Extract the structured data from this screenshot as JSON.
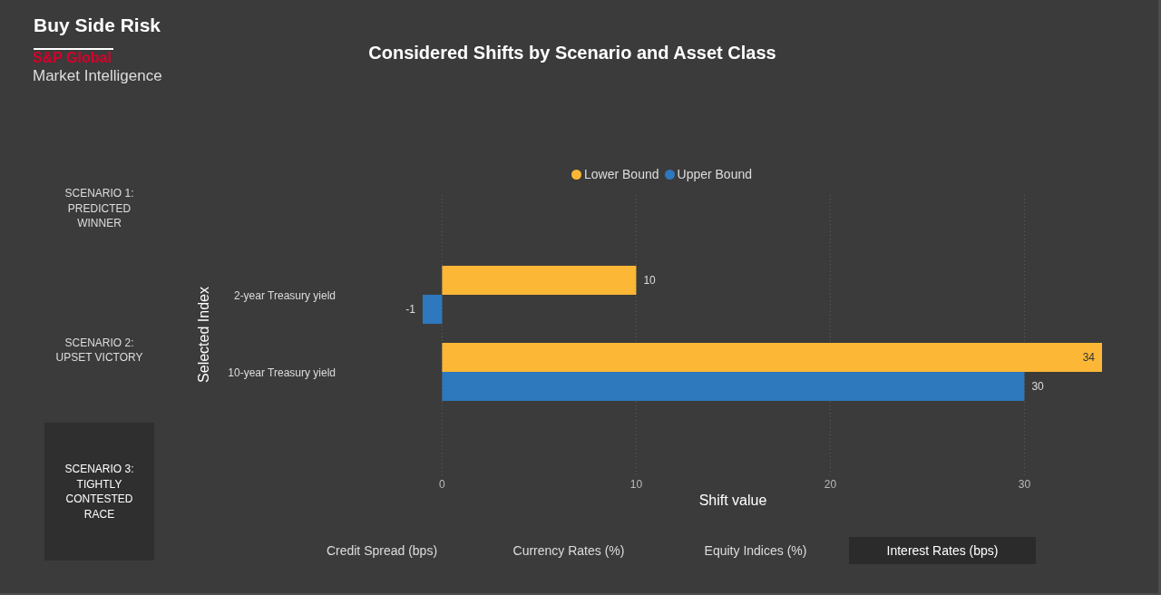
{
  "header": {
    "title": "Buy Side Risk",
    "brand": "S&P Global",
    "brand_subtitle": "Market Intelligence"
  },
  "scenarios": [
    {
      "label": "SCENARIO 1: PREDICTED WINNER",
      "selected": false
    },
    {
      "label": "SCENARIO 2: UPSET VICTORY",
      "selected": false
    },
    {
      "label": "SCENARIO 3: TIGHTLY CONTESTED RACE",
      "selected": true
    }
  ],
  "title": "Considered Shifts by Scenario and Asset Class",
  "chart_data": {
    "type": "bar",
    "orientation": "horizontal",
    "legend": "top",
    "grid": true,
    "xlabel": "Shift value",
    "ylabel": "Selected Index",
    "categories": [
      "2-year Treasury yield",
      "10-year Treasury yield"
    ],
    "series": [
      {
        "name": "Lower Bound",
        "color": "#fbb735",
        "values": [
          10,
          34
        ]
      },
      {
        "name": "Upper Bound",
        "color": "#2e78bd",
        "values": [
          -1,
          30
        ]
      }
    ],
    "xlim": [
      -1,
      34
    ],
    "xticks": [
      0,
      10,
      20,
      30
    ],
    "value_labels": [
      [
        "10",
        "34"
      ],
      [
        "-1",
        "30"
      ]
    ]
  },
  "asset_classes": [
    {
      "label": "Credit Spread (bps)",
      "selected": false
    },
    {
      "label": "Currency Rates (%)",
      "selected": false
    },
    {
      "label": "Equity Indices (%)",
      "selected": false
    },
    {
      "label": "Interest Rates (bps)",
      "selected": true
    }
  ]
}
